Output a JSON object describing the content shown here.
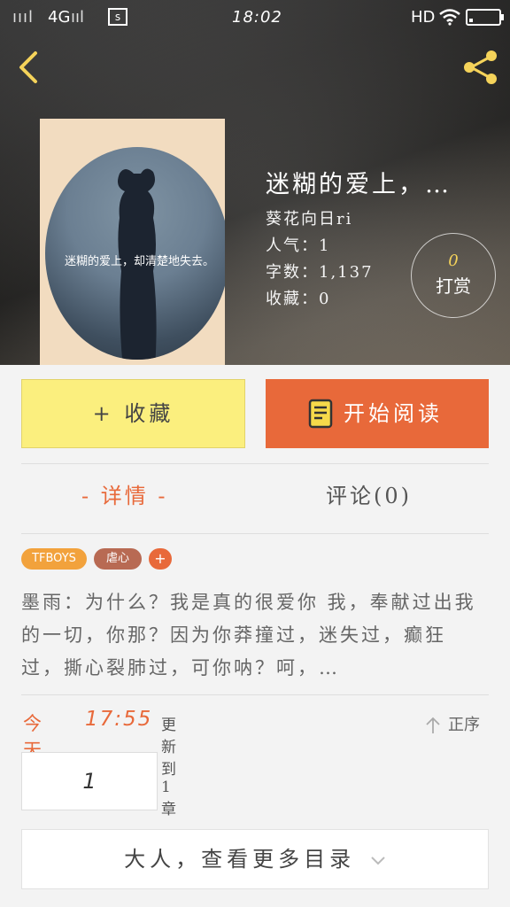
{
  "status_bar": {
    "signal": "ıııl",
    "network": "4G",
    "signal2": "ııl",
    "sim_icon": "sim-icon",
    "time": "18:02",
    "hd": "HD",
    "wifi_icon": "wifi-icon",
    "battery_level": 0.12
  },
  "header": {
    "back_icon": "chevron-left-icon",
    "share_icon": "share-icon",
    "accent": "#f5d35a"
  },
  "cover": {
    "caption": "迷糊的爱上，却清楚地失去。"
  },
  "book": {
    "title": "迷糊的爱上，…",
    "author": "葵花向日ri",
    "popularity": "人气：1",
    "word_count": "字数：1,137",
    "favorites": "收藏：0"
  },
  "reward": {
    "count": "0",
    "label": "打赏"
  },
  "actions": {
    "favorite_label": "+ 收藏",
    "read_label": "开始阅读",
    "fav_color": "#fbef7e",
    "read_color": "#e8693a"
  },
  "tabs": {
    "detail": "- 详情 -",
    "comments": "评论(0)"
  },
  "tags": [
    "TFBOYS",
    "虐心",
    "+"
  ],
  "summary": "墨雨：为什么？我是真的很爱你 我，奉献过出我的一切，你那？因为你莽撞过，迷失过，癫狂过，撕心裂肺过，可你呐？呵，…",
  "update": {
    "day": "今天",
    "time": "17:55",
    "chapters": "更新到1章",
    "sort_label": "正序"
  },
  "chapters": [
    "1"
  ],
  "more_label": "大人，查看更多目录"
}
